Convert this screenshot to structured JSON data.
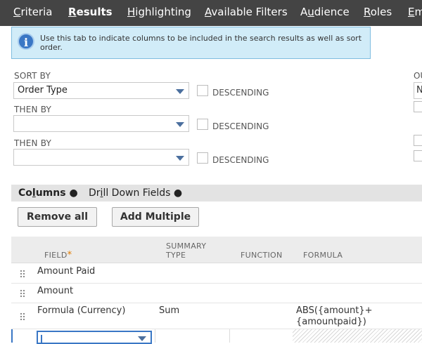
{
  "tabs": [
    {
      "pre": "",
      "u": "C",
      "post": "riteria",
      "active": false
    },
    {
      "pre": "",
      "u": "R",
      "post": "esults",
      "active": true
    },
    {
      "pre": "",
      "u": "H",
      "post": "ighlighting",
      "active": false
    },
    {
      "pre": "",
      "u": "A",
      "post": "vailable Filters",
      "active": false
    },
    {
      "pre": "A",
      "u": "u",
      "post": "dience",
      "active": false
    },
    {
      "pre": "",
      "u": "R",
      "post": "oles",
      "active": false
    },
    {
      "pre": "",
      "u": "E",
      "post": "m",
      "active": false
    }
  ],
  "info": {
    "icon": "info-icon",
    "text": "Use this tab to indicate columns to be included in the search results as well as sort order."
  },
  "sort": {
    "sort_by_label": "SORT BY",
    "sort_by_value": "Order Type",
    "then_by_1_label": "THEN BY",
    "then_by_1_value": "",
    "then_by_2_label": "THEN BY",
    "then_by_2_value": "",
    "descending_label": "DESCENDING"
  },
  "right_panel": {
    "label": "OU",
    "value": "N"
  },
  "subtabs": {
    "columns": {
      "pre": "Co",
      "u": "l",
      "post": "umns ●"
    },
    "drilldown": {
      "pre": "Dr",
      "u": "i",
      "post": "ll Down Fields ●"
    }
  },
  "buttons": {
    "remove_all": "Remove all",
    "add_multiple": "Add Multiple"
  },
  "table": {
    "headers": {
      "field": "FIELD",
      "required_mark": "*",
      "summary_type_1": "SUMMARY",
      "summary_type_2": "TYPE",
      "function": "FUNCTION",
      "formula": "FORMULA"
    },
    "rows": [
      {
        "field": "Amount Paid",
        "summary": "",
        "function": "",
        "formula_1": "",
        "formula_2": ""
      },
      {
        "field": "Amount",
        "summary": "",
        "function": "",
        "formula_1": "",
        "formula_2": ""
      },
      {
        "field": "Formula (Currency)",
        "summary": "Sum",
        "function": "",
        "formula_1": "ABS({amount}+",
        "formula_2": "{amountpaid})"
      }
    ]
  },
  "colors": {
    "tabbar": "#444444",
    "info_bg": "#d1ecf8",
    "accent": "#3a77c5",
    "required": "#e07b00"
  }
}
